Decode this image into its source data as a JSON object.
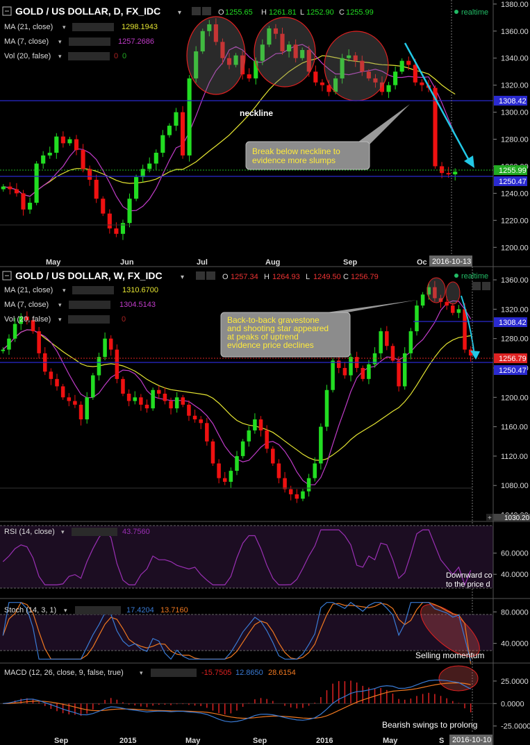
{
  "colors": {
    "background": "#000000",
    "up": "#22dd22",
    "down": "#ee1111",
    "ma21": "#e6e632",
    "ma7": "#c13cc9",
    "trend_arrow": "#22c8e6",
    "neckline": "#2222cc",
    "last_price_line": "#22bb22",
    "rsi_line": "#9b30b5",
    "stoch_k": "#3a7bd5",
    "stoch_d": "#f07820",
    "macd": "#3a7bd5",
    "signal": "#f07820",
    "hist_up": "#dd2222"
  },
  "daily": {
    "title": "GOLD / US DOLLAR, D, FX_IDC",
    "realtime": "realtime",
    "ohlc": {
      "o_label": "O",
      "o": "1255.65",
      "h_label": "H",
      "h": "1261.81",
      "l_label": "L",
      "l": "1252.90",
      "c_label": "C",
      "c": "1255.99"
    },
    "ind1": {
      "label": "MA (21, close)",
      "value": "1298.1943"
    },
    "ind2": {
      "label": "MA (7, close)",
      "value": "1257.2686"
    },
    "ind3": {
      "label": "Vol (20, false)",
      "value": "0",
      "value2": "0"
    },
    "y_ticks": [
      "1380.00",
      "1360.00",
      "1340.00",
      "1320.00",
      "1300.00",
      "1280.00",
      "1260.00",
      "1240.00",
      "1220.00",
      "1200.00"
    ],
    "y_range": [
      1195,
      1383
    ],
    "x_ticks": [
      "May",
      "Jun",
      "Jul",
      "Aug",
      "Sep",
      "Oc"
    ],
    "date_label": "2016-10-13",
    "price_labels": {
      "neckline": "1308.42",
      "last": "1255.99",
      "support": "1250.47"
    },
    "neckline_text": "neckline",
    "callout": "Break below neckline to evidence more slumps"
  },
  "weekly": {
    "title": "GOLD / US DOLLAR, W, FX_IDC",
    "realtime": "realtime",
    "ohlc": {
      "o_label": "O",
      "o": "1257.34",
      "h_label": "H",
      "h": "1264.93",
      "l_label": "L",
      "l": "1249.50",
      "c_label": "C",
      "c": "1256.79"
    },
    "ind1": {
      "label": "MA (21, close)",
      "value": "1310.6700"
    },
    "ind2": {
      "label": "MA (7, close)",
      "value": "1304.5143"
    },
    "ind3": {
      "label": "Vol (20, false)",
      "value": "0"
    },
    "y_ticks": [
      "1360.00",
      "1320.00",
      "1280.00",
      "1240.00",
      "1200.00",
      "1160.00",
      "1120.00",
      "1080.00",
      "1040.00"
    ],
    "y_range": [
      1032,
      1378
    ],
    "bottom_label": "1030.20",
    "price_labels": {
      "neckline": "1308.42",
      "last": "1256.79",
      "support": "1250.47"
    },
    "callout": "Back-to-back gravestone and shooting star appeared at peaks of uptrend evidence price declines"
  },
  "rsi": {
    "label": "RSI (14, close)",
    "value": "43.7560",
    "y_ticks": [
      "60.0000",
      "40.0000"
    ],
    "y_range": [
      27,
      86
    ],
    "annotation_1": "Downward co",
    "annotation_2": "to the price d"
  },
  "stoch": {
    "label": "Stoch (14, 3, 1)",
    "k_value": "17.4204",
    "d_value": "13.7160",
    "y_ticks": [
      "80.0000",
      "40.0000"
    ],
    "y_range": [
      15,
      97
    ],
    "annotation": "Selling momentum"
  },
  "macd": {
    "label": "MACD (12, 26, close, 9, false, true)",
    "v1": "-15.7505",
    "v2": "12.8650",
    "v3": "28.6154",
    "y_ticks": [
      "25.0000",
      "0.0000",
      "-25.0000"
    ],
    "y_range": [
      -33,
      45
    ],
    "annotation": "Bearish swings to prolong",
    "x_ticks": [
      "Sep",
      "2015",
      "May",
      "Sep",
      "2016",
      "May",
      "S"
    ],
    "date_label": "2016-10-10"
  },
  "chart_data": [
    {
      "type": "candlestick",
      "title": "GOLD / US DOLLAR, D, FX_IDC",
      "timeframe": "daily",
      "x_ticks": [
        "May",
        "Jun",
        "Jul",
        "Aug",
        "Sep",
        "Oc"
      ],
      "ylim": [
        1195,
        1383
      ],
      "last_ohlc": {
        "open": 1255.65,
        "high": 1261.81,
        "low": 1252.9,
        "close": 1255.99
      },
      "ma21_last": 1298.1943,
      "ma7_last": 1257.2686,
      "levels": {
        "neckline": 1308.42,
        "support": 1250.47,
        "last": 1255.99
      },
      "approx_close_path": [
        1245,
        1243,
        1240,
        1228,
        1233,
        1262,
        1268,
        1270,
        1282,
        1277,
        1280,
        1272,
        1258,
        1250,
        1236,
        1225,
        1214,
        1210,
        1218,
        1236,
        1252,
        1258,
        1262,
        1270,
        1283,
        1290,
        1300,
        1268,
        1325,
        1345,
        1360,
        1365,
        1352,
        1340,
        1335,
        1342,
        1328,
        1325,
        1338,
        1350,
        1362,
        1358,
        1345,
        1350,
        1340,
        1346,
        1330,
        1322,
        1320,
        1315,
        1325,
        1340,
        1342,
        1338,
        1330,
        1325,
        1322,
        1315,
        1320,
        1330,
        1338,
        1335,
        1322,
        1320,
        1318,
        1260,
        1255,
        1254,
        1256
      ]
    },
    {
      "type": "candlestick",
      "title": "GOLD / US DOLLAR, W, FX_IDC",
      "timeframe": "weekly",
      "x_ticks": [
        "Sep",
        "2015",
        "May",
        "Sep",
        "2016",
        "May",
        "S"
      ],
      "ylim": [
        1032,
        1378
      ],
      "last_ohlc": {
        "open": 1257.34,
        "high": 1264.93,
        "low": 1249.5,
        "close": 1256.79
      },
      "ma21_last": 1310.67,
      "ma7_last": 1304.5143,
      "levels": {
        "neckline": 1308.42,
        "support": 1250.47,
        "last": 1256.79
      },
      "approx_close_path": [
        1265,
        1280,
        1300,
        1310,
        1305,
        1290,
        1260,
        1235,
        1225,
        1215,
        1200,
        1195,
        1190,
        1170,
        1200,
        1230,
        1255,
        1280,
        1265,
        1225,
        1205,
        1195,
        1200,
        1190,
        1185,
        1210,
        1205,
        1195,
        1185,
        1200,
        1190,
        1175,
        1170,
        1165,
        1140,
        1110,
        1090,
        1085,
        1100,
        1120,
        1140,
        1155,
        1170,
        1155,
        1130,
        1110,
        1090,
        1075,
        1068,
        1062,
        1072,
        1090,
        1110,
        1160,
        1210,
        1250,
        1240,
        1230,
        1255,
        1240,
        1225,
        1245,
        1260,
        1290,
        1270,
        1250,
        1215,
        1260,
        1290,
        1325,
        1340,
        1350,
        1335,
        1330,
        1325,
        1315,
        1320,
        1265,
        1257
      ]
    },
    {
      "type": "line",
      "title": "RSI (14, close)",
      "last": 43.756,
      "ylim": [
        27,
        86
      ],
      "y_ticks": [
        60,
        40
      ]
    },
    {
      "type": "line",
      "title": "Stoch (14, 3, 1)",
      "series": [
        {
          "name": "%K",
          "last": 17.4204
        },
        {
          "name": "%D",
          "last": 13.716
        }
      ],
      "ylim": [
        15,
        97
      ],
      "y_ticks": [
        80,
        40
      ]
    },
    {
      "type": "line",
      "title": "MACD (12, 26, close, 9, false, true)",
      "series": [
        {
          "name": "histogram",
          "last": -15.7505
        },
        {
          "name": "MACD",
          "last": 12.865
        },
        {
          "name": "signal",
          "last": 28.6154
        }
      ],
      "ylim": [
        -33,
        45
      ],
      "y_ticks": [
        25,
        0,
        -25
      ]
    }
  ]
}
